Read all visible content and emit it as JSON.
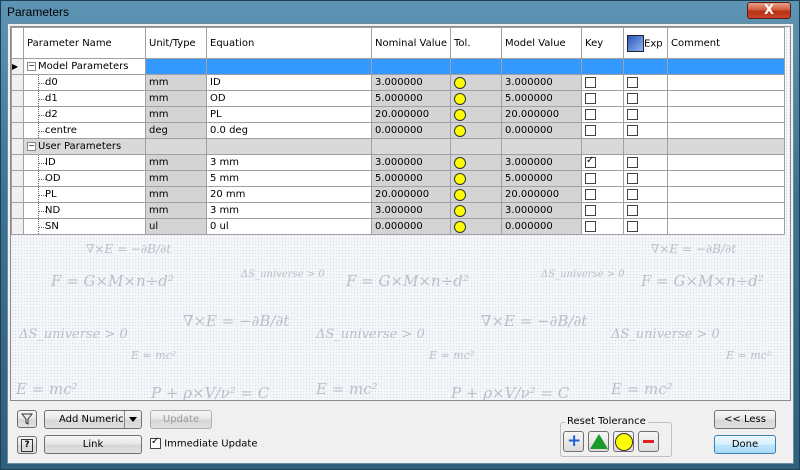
{
  "window": {
    "title": "Parameters",
    "close_glyph": "X"
  },
  "columns": [
    "Parameter Name",
    "Unit/Type",
    "Equation",
    "Nominal Value",
    "Tol.",
    "Model Value",
    "Key",
    "Exp",
    "Comment"
  ],
  "groups": [
    {
      "label": "Model Parameters",
      "rows": [
        {
          "name": "d0",
          "unit": "mm",
          "equation": "ID",
          "nominal": "3.000000",
          "model": "3.000000",
          "key": false,
          "exp": false
        },
        {
          "name": "d1",
          "unit": "mm",
          "equation": "OD",
          "nominal": "5.000000",
          "model": "5.000000",
          "key": false,
          "exp": false
        },
        {
          "name": "d2",
          "unit": "mm",
          "equation": "PL",
          "nominal": "20.000000",
          "model": "20.000000",
          "key": false,
          "exp": false
        },
        {
          "name": "centre",
          "unit": "deg",
          "equation": "0.0 deg",
          "nominal": "0.000000",
          "model": "0.000000",
          "key": false,
          "exp": false
        }
      ]
    },
    {
      "label": "User Parameters",
      "rows": [
        {
          "name": "ID",
          "unit": "mm",
          "equation": "3 mm",
          "nominal": "3.000000",
          "model": "3.000000",
          "key": true,
          "exp": false
        },
        {
          "name": "OD",
          "unit": "mm",
          "equation": "5 mm",
          "nominal": "5.000000",
          "model": "5.000000",
          "key": false,
          "exp": false
        },
        {
          "name": "PL",
          "unit": "mm",
          "equation": "20 mm",
          "nominal": "20.000000",
          "model": "20.000000",
          "key": false,
          "exp": false
        },
        {
          "name": "ND",
          "unit": "mm",
          "equation": "3 mm",
          "nominal": "3.000000",
          "model": "3.000000",
          "key": false,
          "exp": false
        },
        {
          "name": "SN",
          "unit": "ul",
          "equation": "0 ul",
          "nominal": "0.000000",
          "model": "0.000000",
          "key": false,
          "exp": false
        }
      ]
    }
  ],
  "watermark": {
    "formula_f": "F = G×M×n÷d²",
    "formula_curl": "∇×E = −∂B/∂t",
    "formula_entropy": "ΔS_universe > 0",
    "formula_emc": "E = mc²",
    "formula_bern": "P + ρ×V/ν² = C"
  },
  "toolbar": {
    "filter_icon": "filter-icon",
    "help_icon": "help-icon",
    "add_numeric": "Add Numeric",
    "update": "Update",
    "link": "Link",
    "immediate_update": "Immediate Update",
    "immediate_update_checked": true,
    "reset_tolerance": "Reset Tolerance",
    "less": "<< Less",
    "done": "Done"
  },
  "colors": {
    "selection": "#3399ff",
    "tolerance_nominal": "#ffff00",
    "tol_upper": "#1c5fd6",
    "tol_median": "#1a9a2a",
    "tol_lower": "#e02020"
  }
}
